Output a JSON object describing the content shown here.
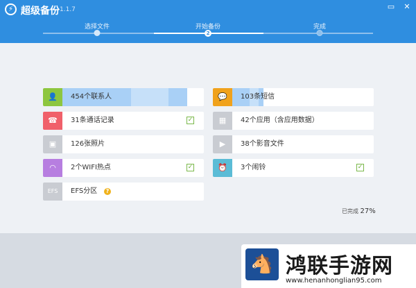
{
  "app": {
    "title": "超级备份",
    "version": "1.1.7"
  },
  "steps": [
    {
      "label": "选择文件",
      "state": "done"
    },
    {
      "label": "开始备份",
      "state": "current",
      "number": "2"
    },
    {
      "label": "完成",
      "state": "todo"
    }
  ],
  "items_left": [
    {
      "label": "454个联系人",
      "icon": "contact-icon",
      "color": "#8dc63f",
      "progress": 0.88,
      "checked": false
    },
    {
      "label": "31条通话记录",
      "icon": "phone-icon",
      "color": "#f0606a",
      "checked": true
    },
    {
      "label": "126张照片",
      "icon": "photo-icon",
      "color": "#c9ccd2",
      "checked": false
    },
    {
      "label": "2个WIFI热点",
      "icon": "wifi-icon",
      "color": "#b77ee0",
      "checked": true
    },
    {
      "label": "EFS分区",
      "icon": "efs-icon",
      "icon_text": "EFS",
      "color": "#c9ccd2",
      "warning": true
    }
  ],
  "items_right": [
    {
      "label": "103条短信",
      "icon": "message-icon",
      "color": "#f0a21c",
      "progress": 0.22,
      "checked": false
    },
    {
      "label": "42个应用（含应用数据）",
      "icon": "apps-icon",
      "color": "#c9ccd2",
      "checked": false
    },
    {
      "label": "38个影音文件",
      "icon": "media-icon",
      "color": "#c9ccd2",
      "checked": false
    },
    {
      "label": "3个闹铃",
      "icon": "alarm-icon",
      "color": "#5bbcd6",
      "checked": true
    }
  ],
  "status": {
    "label": "已完成",
    "percent": "27%"
  },
  "watermark": {
    "title": "鸿联手游网",
    "url": "www.henanhonglian95.com"
  },
  "colors": {
    "header": "#2f8ee0",
    "progress": "#a9d0f6"
  }
}
